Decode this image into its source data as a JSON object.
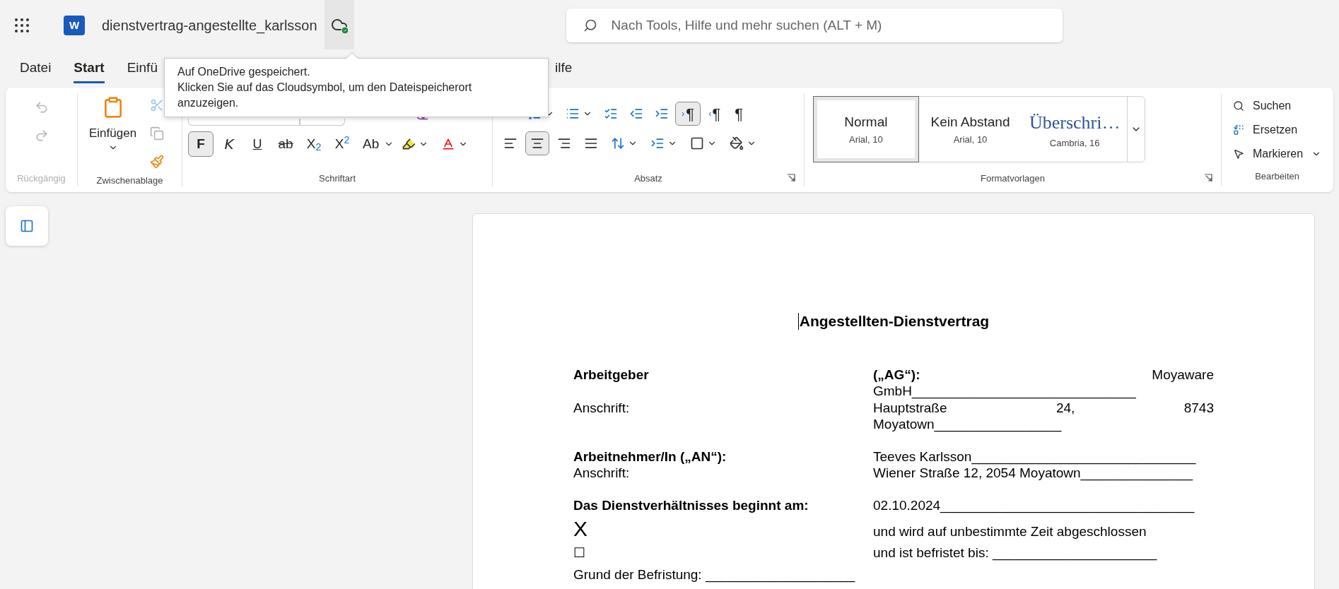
{
  "title_bar": {
    "app_letter": "W",
    "document_title": "dienstvertrag-angestellte_karlsson",
    "search": {
      "placeholder": "Nach Tools, Hilfe und mehr suchen (ALT + M)"
    }
  },
  "tooltip": {
    "heading": "Auf OneDrive gespeichert.",
    "text": "Klicken Sie auf das Cloudsymbol, um den Dateispeicherort anzuzeigen."
  },
  "tabs": [
    {
      "label": "Datei",
      "selected": false
    },
    {
      "label": "Start",
      "selected": true
    },
    {
      "label": "Einfü",
      "selected": false
    },
    {
      "label": "ilfe",
      "selected": false
    }
  ],
  "ribbon": {
    "undo": {
      "label": "Rückgängig",
      "disabled": true
    },
    "clipboard": {
      "label": "Zwischenablage",
      "paste": "Einfügen"
    },
    "font": {
      "label": "Schriftart",
      "buttons": [
        {
          "kind": "bold",
          "text": "F",
          "selected": true
        },
        {
          "kind": "italic",
          "text": "K",
          "selected": false
        },
        {
          "kind": "underline",
          "text": "U",
          "selected": false
        },
        {
          "kind": "strike",
          "text": "ab",
          "selected": false
        },
        {
          "kind": "subscript",
          "text": "X$_{2}$",
          "selected": false
        },
        {
          "kind": "superscript",
          "text": "X$^{2}$",
          "selected": false
        },
        {
          "kind": "case",
          "text": "Ab",
          "selected": false
        }
      ]
    },
    "paragraph": {
      "label": "Absatz",
      "marks": [
        {
          "kind": "ltr",
          "arrow": "›",
          "text": "¶",
          "selected": true
        },
        {
          "kind": "rtl",
          "arrow": "‹",
          "text": "¶",
          "selected": false
        },
        {
          "kind": "show",
          "text": "¶",
          "selected": false
        }
      ],
      "alignment": [
        {
          "kind": "left",
          "selected": false
        },
        {
          "kind": "center",
          "selected": true
        },
        {
          "kind": "right",
          "selected": false
        },
        {
          "kind": "justify",
          "selected": false
        }
      ]
    },
    "styles": {
      "label": "Formatvorlagen",
      "items": [
        {
          "kind": "body",
          "name": "Normal",
          "font": "Arial, 10",
          "selected": true
        },
        {
          "kind": "body",
          "name": "Kein Abstand",
          "font": "Arial, 10",
          "selected": false
        },
        {
          "kind": "heading",
          "name": "Überschri…",
          "font": "Cambria, 16",
          "selected": false
        }
      ]
    },
    "editing": {
      "label": "Bearbeiten",
      "items": [
        {
          "kind": "find",
          "label": "Suchen"
        },
        {
          "kind": "replace",
          "label": "Ersetzen"
        },
        {
          "kind": "select",
          "label": "Markieren"
        }
      ]
    }
  },
  "document": {
    "title": "Angestellten-Dienstvertrag",
    "groups": [
      [
        {
          "label": "Arbeitgeber",
          "bold": true,
          "lines": [
            [
              {
                "text": "(„AG“):",
                "bold": true
              },
              {
                "text": "Moyaware"
              }
            ],
            [
              {
                "text": "GmbH______________________________"
              }
            ]
          ]
        },
        {
          "label": "Anschrift:",
          "bold": false,
          "lines": [
            [
              {
                "text": "Hauptstraße"
              },
              {
                "text": "24,"
              },
              {
                "text": "8743"
              }
            ],
            [
              {
                "text": "Moyatown_________________"
              }
            ]
          ]
        }
      ],
      [
        {
          "label": "Arbeitnehmer/In („AN“):",
          "bold": true,
          "lines": [
            [
              {
                "text": "Teeves Karlsson______________________________"
              }
            ]
          ]
        },
        {
          "label": "Anschrift:",
          "bold": false,
          "lines": [
            [
              {
                "text": "Wiener Straße 12, 2054 Moyatown_______________"
              }
            ]
          ]
        }
      ],
      [
        {
          "label": "Das Dienstverhältnisses beginnt am:",
          "bold": true,
          "lines": [
            [
              {
                "text": "02.10.2024__________________________________"
              }
            ]
          ]
        },
        {
          "label": "X",
          "bold": false,
          "kind": "mark",
          "lines": [
            [
              {
                "text": "und wird auf unbestimmte Zeit abgeschlossen"
              }
            ]
          ]
        },
        {
          "label": "☐",
          "bold": false,
          "lines": [
            [
              {
                "text": "und ist befristet bis: ______________________"
              }
            ]
          ]
        },
        {
          "label": "Grund der Befristung: ____________________",
          "bold": false
        }
      ]
    ]
  }
}
